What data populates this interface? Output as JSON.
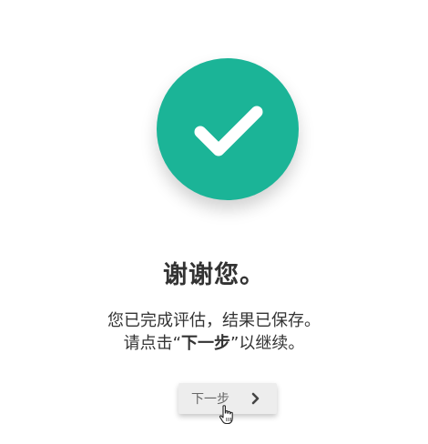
{
  "dialog": {
    "title": "谢谢您。",
    "message_line1": "您已完成评估，结果已保存。",
    "message_line2_prefix": "请点击“",
    "message_line2_strong": "下一步",
    "message_line2_suffix": "”以继续。"
  },
  "next_button": {
    "label": "下一步",
    "icon": "chevron-right-icon"
  },
  "status_icon": {
    "icon": "checkmark-icon",
    "circle_color": "#1bb497",
    "check_color": "#ffffff"
  },
  "pointer": {
    "icon": "hand-pointer-cursor-icon"
  }
}
